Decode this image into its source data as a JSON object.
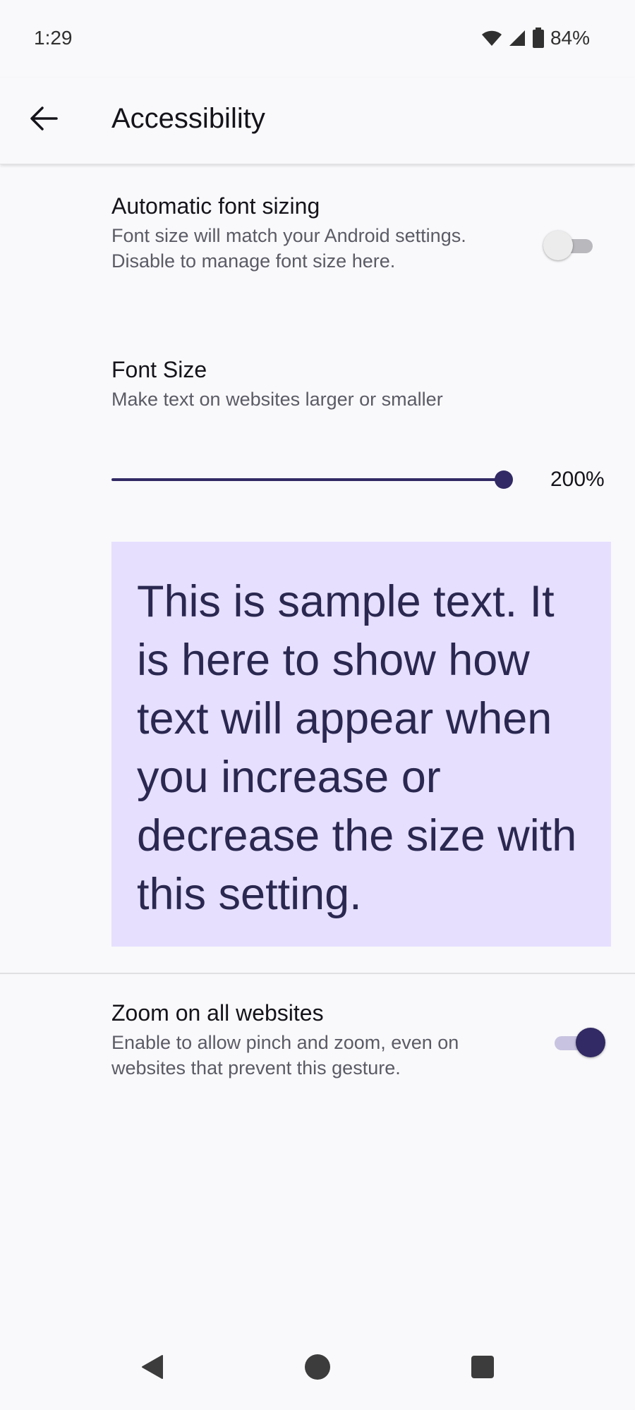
{
  "status_bar": {
    "time": "1:29",
    "battery_percent": "84%",
    "icons": [
      "wifi-icon",
      "cell-signal-icon",
      "battery-icon"
    ]
  },
  "app_bar": {
    "title": "Accessibility",
    "back_icon": "arrow-left-icon"
  },
  "settings": {
    "auto_font": {
      "title": "Automatic font sizing",
      "summary": "Font size will match your Android settings. Disable to manage font size here.",
      "enabled": false
    },
    "font_size": {
      "title": "Font Size",
      "summary": "Make text on websites larger or smaller",
      "value_label": "200%",
      "slider_fraction": 1.0
    },
    "sample_text": "This is sample text. It is here to show how text will appear when you increase or decrease the size with this setting.",
    "zoom": {
      "title": "Zoom on all websites",
      "summary": "Enable to allow pinch and zoom, even on websites that prevent this gesture.",
      "enabled": true
    }
  },
  "nav_bar": {
    "buttons": [
      "back-triangle-icon",
      "home-circle-icon",
      "recents-square-icon"
    ]
  },
  "colors": {
    "accent": "#312a64",
    "sample_background": "#e6dffe",
    "background": "#f9f9fb"
  }
}
